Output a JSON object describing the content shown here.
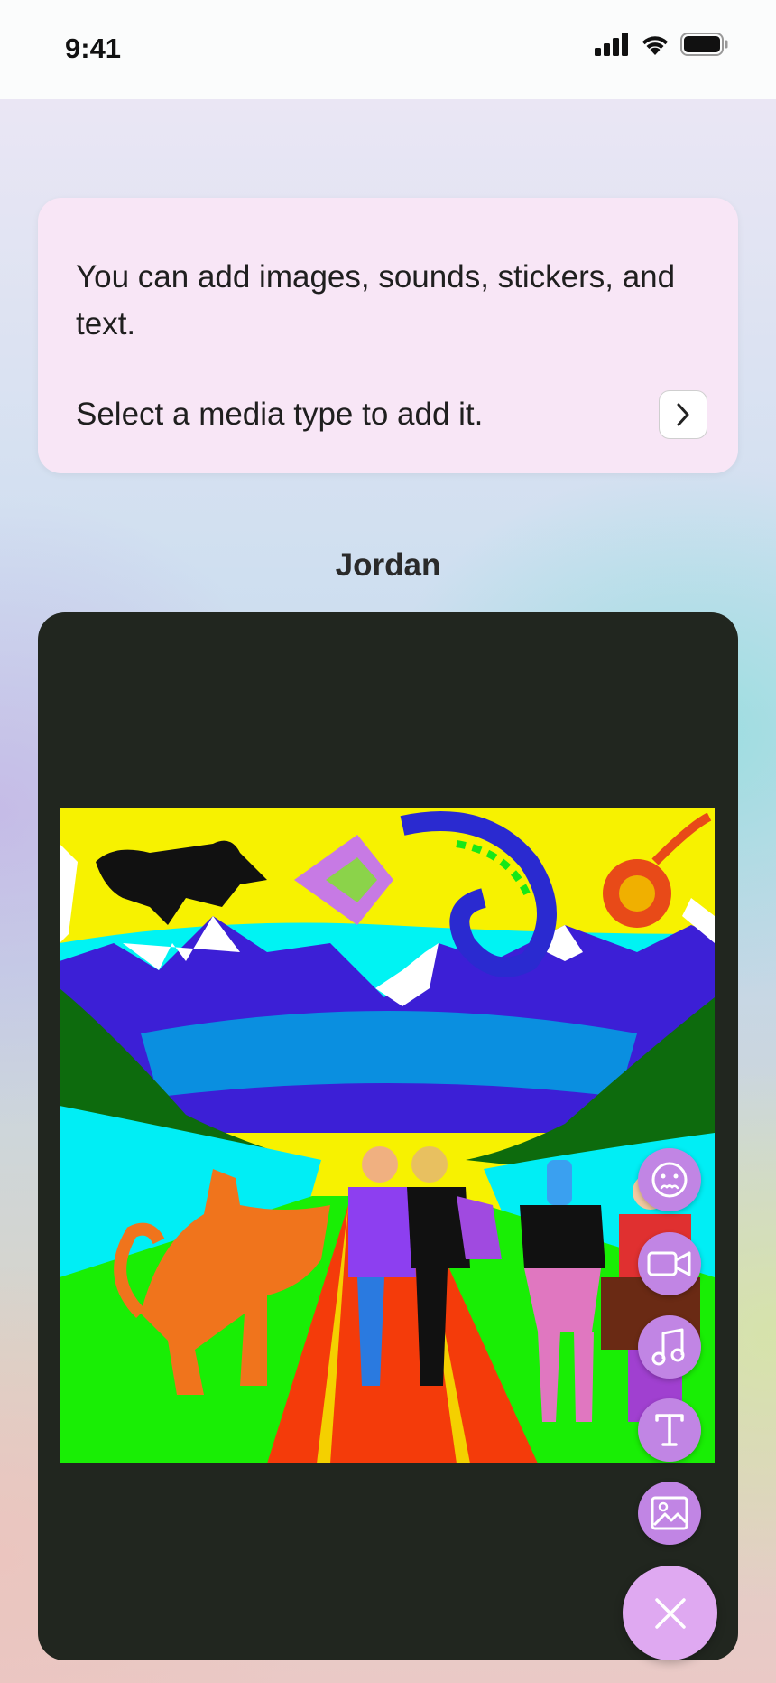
{
  "status_bar": {
    "time": "9:41",
    "icons": [
      "cellular-signal-icon",
      "wifi-icon",
      "battery-icon"
    ]
  },
  "info_card": {
    "line1": "You can add images, sounds, stickers, and text.",
    "line2": "Select a media type to add it.",
    "next_icon": "chevron-right-icon"
  },
  "canvas": {
    "name": "Jordan",
    "image_description_icon": "colorful-illustration-image"
  },
  "media_menu": {
    "items": [
      {
        "icon": "sticker-face-icon"
      },
      {
        "icon": "video-camera-icon"
      },
      {
        "icon": "music-note-icon"
      },
      {
        "icon": "text-icon"
      },
      {
        "icon": "image-icon"
      }
    ],
    "close_icon": "close-icon"
  },
  "colors": {
    "accent": "#c185e4",
    "close_button": "#dfa9f1",
    "card_background": "#f8e6f6",
    "canvas_background": "#21261f"
  }
}
